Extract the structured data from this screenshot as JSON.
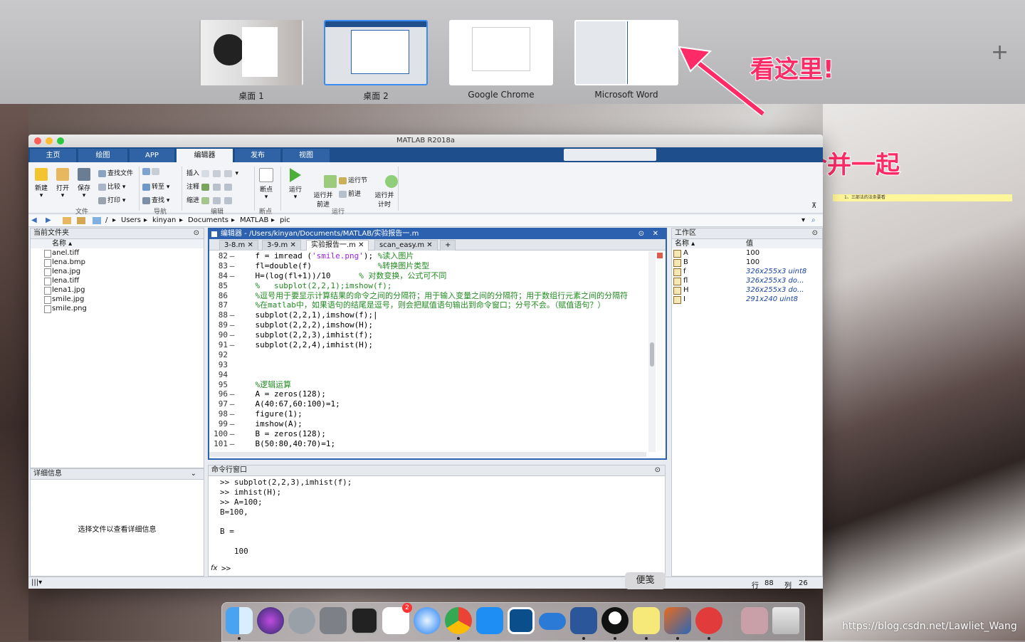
{
  "spaces": [
    {
      "label": "桌面 1",
      "active": false
    },
    {
      "label": "桌面 2",
      "active": true
    },
    {
      "label": "Google Chrome",
      "active": false
    },
    {
      "label": "Microsoft Word",
      "active": false
    }
  ],
  "add_space": "+",
  "annotations": {
    "look_here": "看这里!",
    "two_screens": "这是两个屏幕合并一起"
  },
  "matlab": {
    "window_title": "MATLAB R2018a",
    "ribbon_tabs": [
      "主页",
      "绘图",
      "APP",
      "编辑器",
      "发布",
      "视图"
    ],
    "ribbon": {
      "new": "新建",
      "open": "打开",
      "save": "保存",
      "find_files": "查找文件",
      "compare": "比较",
      "print": "打印",
      "goto": "转至",
      "find": "查找",
      "insert": "插入",
      "comment": "注释",
      "indent": "缩进",
      "breakpoints": "断点",
      "run": "运行",
      "run_advance": "运行并\n前进",
      "run_section": "运行节",
      "advance": "前进",
      "run_time": "运行并\n计时",
      "groups": [
        "文件",
        "导航",
        "编辑",
        "断点",
        "运行"
      ]
    },
    "address": [
      "/",
      "Users",
      "kinyan",
      "Documents",
      "MATLAB",
      "pic"
    ],
    "current_folder": {
      "title": "当前文件夹",
      "column": "名称 ▴",
      "files": [
        "anel.tiff",
        "lena.bmp",
        "lena.jpg",
        "lena.tiff",
        "lena1.jpg",
        "smile.jpg",
        "smile.png"
      ]
    },
    "details": {
      "title": "详细信息",
      "empty": "选择文件以查看详细信息"
    },
    "editor": {
      "title": "编辑器 - /Users/kinyan/Documents/MATLAB/实验报告一.m",
      "tabs": [
        "3-8.m",
        "3-9.m",
        "实验报告一.m",
        "scan_easy.m",
        "+"
      ],
      "lines": [
        {
          "n": "82",
          "d": "–",
          "parts": [
            [
              "ct",
              "    f = imread ("
            ],
            [
              "str",
              "'smile.png'"
            ],
            [
              "ct",
              "); "
            ],
            [
              "cmt",
              "%读入图片"
            ]
          ]
        },
        {
          "n": "83",
          "d": "–",
          "parts": [
            [
              "ct",
              "    fl=double(f)              "
            ],
            [
              "cmt",
              "%转换图片类型"
            ]
          ]
        },
        {
          "n": "84",
          "d": "–",
          "parts": [
            [
              "ct",
              "    H=(log(fl+1))/10      "
            ],
            [
              "cmt",
              "% 对数变换，公式可不同"
            ]
          ]
        },
        {
          "n": "85",
          "d": "",
          "parts": [
            [
              "cmt",
              "    %   subplot(2,2,1);imshow(f);"
            ]
          ]
        },
        {
          "n": "86",
          "d": "",
          "parts": [
            [
              "cmt",
              "    %逗号用于要显示计算结果的命令之间的分隔符；用于输入变量之间的分隔符；用于数组行元素之间的分隔符"
            ]
          ]
        },
        {
          "n": "87",
          "d": "",
          "parts": [
            [
              "cmt",
              "    %在matlab中，如果语句的结尾是逗号，则会把赋值语句输出到命令窗口；分号不会。（赋值语句？）"
            ]
          ]
        },
        {
          "n": "88",
          "d": "–",
          "parts": [
            [
              "ct",
              "    subplot(2,2,1),imshow(f);|"
            ]
          ]
        },
        {
          "n": "89",
          "d": "–",
          "parts": [
            [
              "ct",
              "    subplot(2,2,2),imshow(H);"
            ]
          ]
        },
        {
          "n": "90",
          "d": "–",
          "parts": [
            [
              "ct",
              "    subplot(2,2,3),imhist(f);"
            ]
          ]
        },
        {
          "n": "91",
          "d": "–",
          "parts": [
            [
              "ct",
              "    subplot(2,2,4),imhist(H);"
            ]
          ]
        },
        {
          "n": "92",
          "d": "",
          "parts": [
            [
              "ct",
              ""
            ]
          ]
        },
        {
          "n": "93",
          "d": "",
          "parts": [
            [
              "ct",
              ""
            ]
          ]
        },
        {
          "n": "94",
          "d": "",
          "parts": [
            [
              "ct",
              ""
            ]
          ]
        },
        {
          "n": "95",
          "d": "",
          "parts": [
            [
              "cmt",
              "    %逻辑运算"
            ]
          ]
        },
        {
          "n": "96",
          "d": "–",
          "parts": [
            [
              "ct",
              "    A = zeros(128);"
            ]
          ]
        },
        {
          "n": "97",
          "d": "–",
          "parts": [
            [
              "ct",
              "    A(40:67,60:100)=1;"
            ]
          ]
        },
        {
          "n": "98",
          "d": "–",
          "parts": [
            [
              "ct",
              "    figure(1);"
            ]
          ]
        },
        {
          "n": "99",
          "d": "–",
          "parts": [
            [
              "ct",
              "    imshow(A);"
            ]
          ]
        },
        {
          "n": "100",
          "d": "–",
          "parts": [
            [
              "ct",
              "    B = zeros(128);"
            ]
          ]
        },
        {
          "n": "101",
          "d": "–",
          "parts": [
            [
              "ct",
              "    B(50:80,40:70)=1;"
            ]
          ]
        }
      ]
    },
    "command_window": {
      "title": "命令行窗口",
      "lines": [
        ">> subplot(2,2,3),imhist(f);",
        ">> imhist(H);",
        ">> A=100;",
        "B=100,",
        "",
        "B =",
        "",
        "   100",
        ""
      ],
      "prompt_fx": "fx",
      "prompt": ">>"
    },
    "workspace": {
      "title": "工作区",
      "col_name": "名称 ▴",
      "col_value": "值",
      "vars": [
        {
          "name": "A",
          "value": "100",
          "italic": false
        },
        {
          "name": "B",
          "value": "100",
          "italic": false
        },
        {
          "name": "f",
          "value": "326x255x3 uint8",
          "italic": true
        },
        {
          "name": "fl",
          "value": "326x255x3 do...",
          "italic": true
        },
        {
          "name": "H",
          "value": "326x255x3 do...",
          "italic": true
        },
        {
          "name": "I",
          "value": "291x240 uint8",
          "italic": true
        }
      ]
    },
    "status": {
      "row_label": "行",
      "row": "88",
      "col_label": "列",
      "col": "26"
    }
  },
  "note_text": "1、三部法的法条要看",
  "dock": {
    "tooltip": "便笺",
    "badge": "2",
    "apps": [
      "finder-icon",
      "siri-icon",
      "launchpad-icon",
      "system-preferences-icon",
      "activity-monitor-icon",
      "reminders-icon",
      "safari-icon",
      "chrome-icon",
      "app-store-icon",
      "jetbrains-icon",
      "onedrive-icon",
      "word-icon",
      "qq-icon",
      "stickies-icon",
      "matlab-icon",
      "netease-music-icon",
      "photos-stack-icon",
      "trash-icon"
    ]
  },
  "watermark": "https://blog.csdn.net/Lawliet_Wang"
}
